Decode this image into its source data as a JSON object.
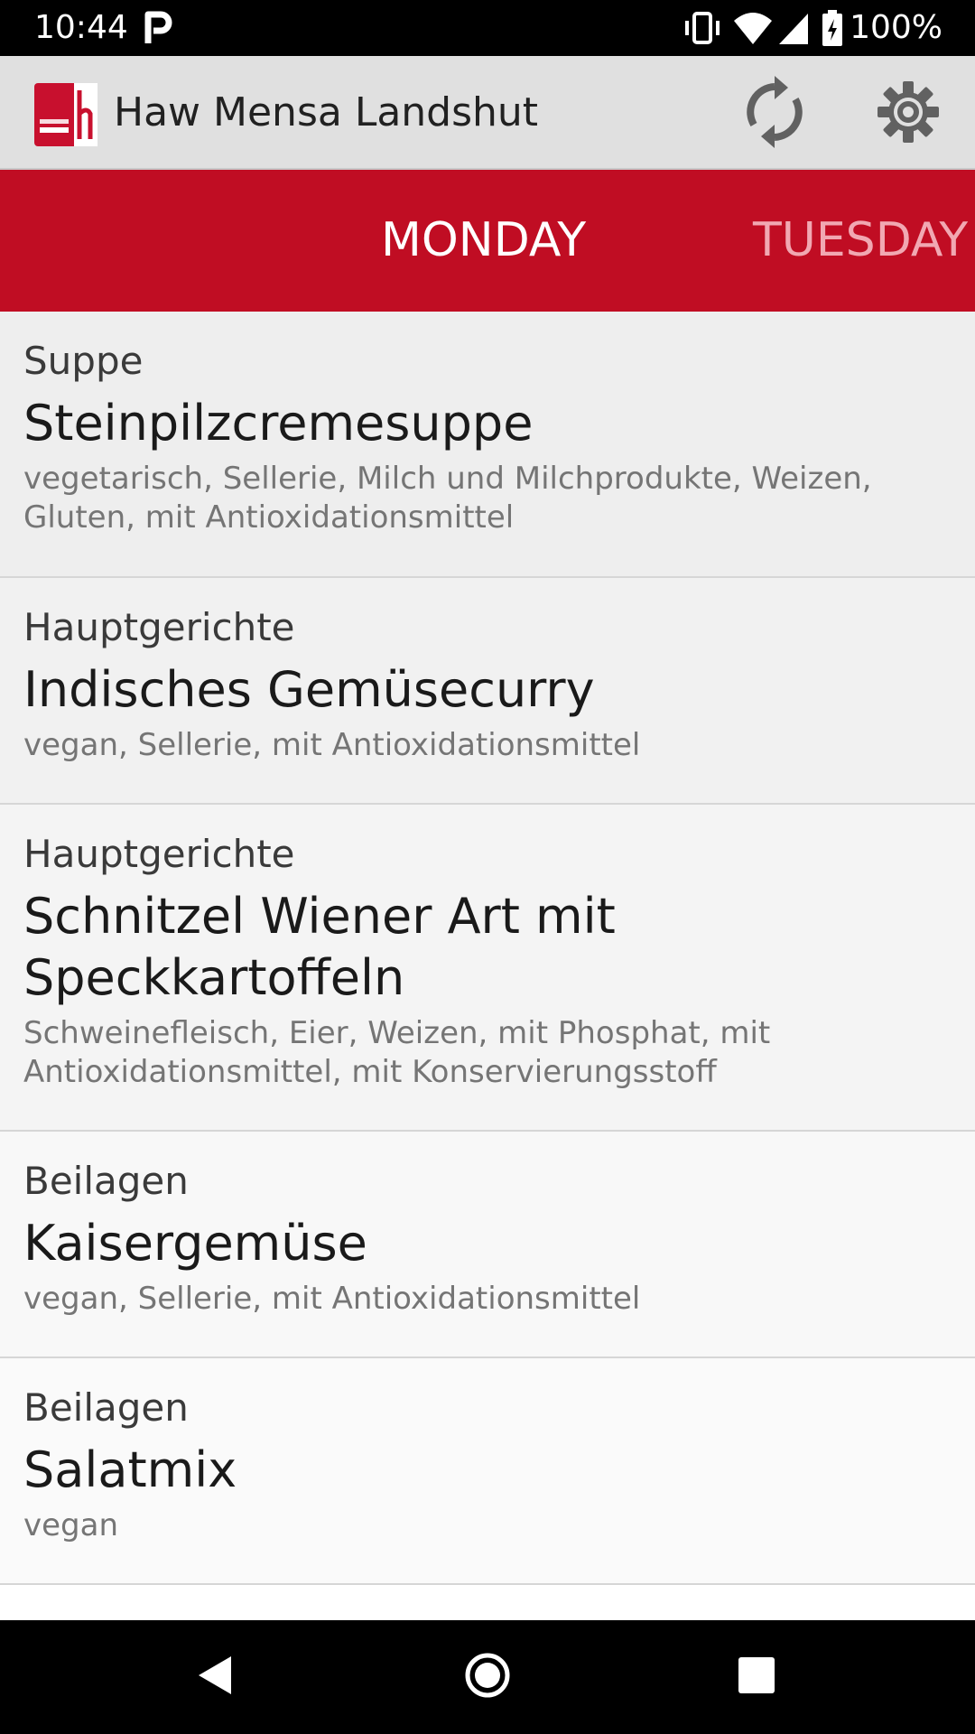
{
  "status_bar": {
    "time": "10:44",
    "battery_percent": "100%",
    "icons": [
      "parking-icon",
      "vibrate-icon",
      "wifi-icon",
      "cell-signal-icon",
      "battery-charging-icon"
    ]
  },
  "app_bar": {
    "title": "Haw Mensa Landshut",
    "logo_icon": "hochschule-landshut-logo",
    "actions": [
      "refresh-icon",
      "settings-gear-icon"
    ]
  },
  "tabs": {
    "items": [
      {
        "label": "MONDAY",
        "selected": true
      },
      {
        "label": "TUESDAY",
        "selected": false
      }
    ]
  },
  "colors": {
    "tab_background": "#c00d23",
    "tab_selected_text": "#ffffff",
    "tab_unselected_text": "#f1a8b2",
    "app_bar_background": "#e0e0e0"
  },
  "menu": {
    "items": [
      {
        "category": "Suppe",
        "name": "Steinpilzcremesuppe",
        "info": "vegetarisch, Sellerie, Milch und Milchprodukte, Weizen, Gluten, mit Antioxidationsmittel"
      },
      {
        "category": "Hauptgerichte",
        "name": "Indisches Gemüsecurry",
        "info": "vegan, Sellerie, mit Antioxidationsmittel"
      },
      {
        "category": "Hauptgerichte",
        "name": "Schnitzel Wiener Art mit Speckkartoffeln",
        "info": "Schweinefleisch, Eier, Weizen, mit Phosphat, mit Antioxidationsmittel, mit Konservierungsstoff"
      },
      {
        "category": "Beilagen",
        "name": "Kaisergemüse",
        "info": "vegan, Sellerie, mit Antioxidationsmittel"
      },
      {
        "category": "Beilagen",
        "name": "Salatmix",
        "info": "vegan"
      }
    ]
  },
  "nav_bar": {
    "buttons": [
      "back-icon",
      "home-icon",
      "recents-icon"
    ]
  }
}
